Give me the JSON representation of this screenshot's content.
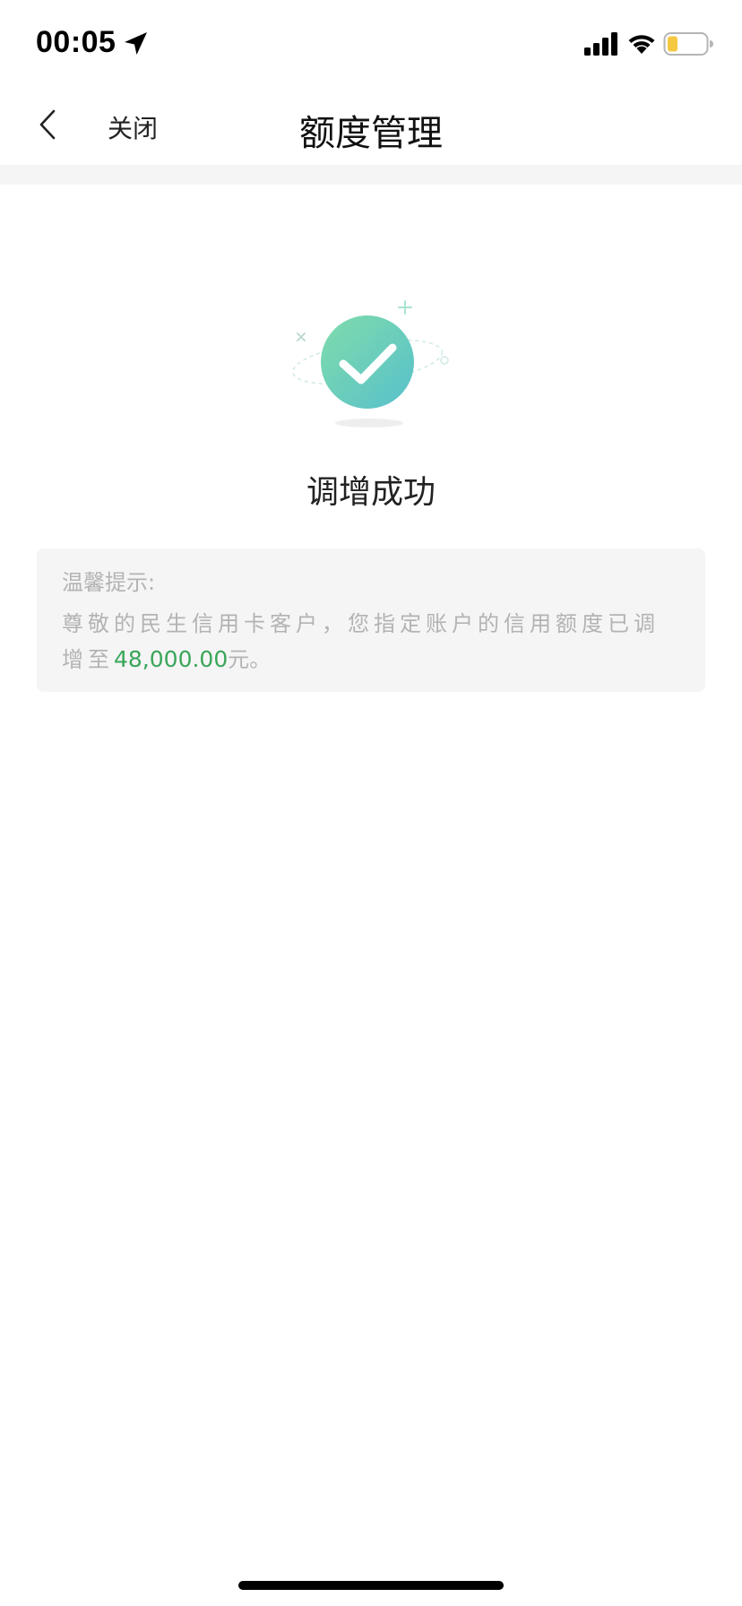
{
  "status_bar": {
    "time": "00:05",
    "icons": [
      "location-arrow-icon",
      "cellular-signal-icon",
      "wifi-icon",
      "battery-icon"
    ],
    "battery_color": "#f5c842"
  },
  "nav": {
    "back_icon": "chevron-left-icon",
    "close_label": "关闭",
    "title": "额度管理"
  },
  "result": {
    "icon": "success-check-icon",
    "title": "调增成功",
    "accent_color": "#5cc9b0"
  },
  "tip": {
    "heading": "温馨提示:",
    "body": "尊敬的民生信用卡客户，您指定账户的信用额度已调增至",
    "amount": "48,000.00",
    "amount_color": "#3aa65a",
    "unit": "元。"
  }
}
